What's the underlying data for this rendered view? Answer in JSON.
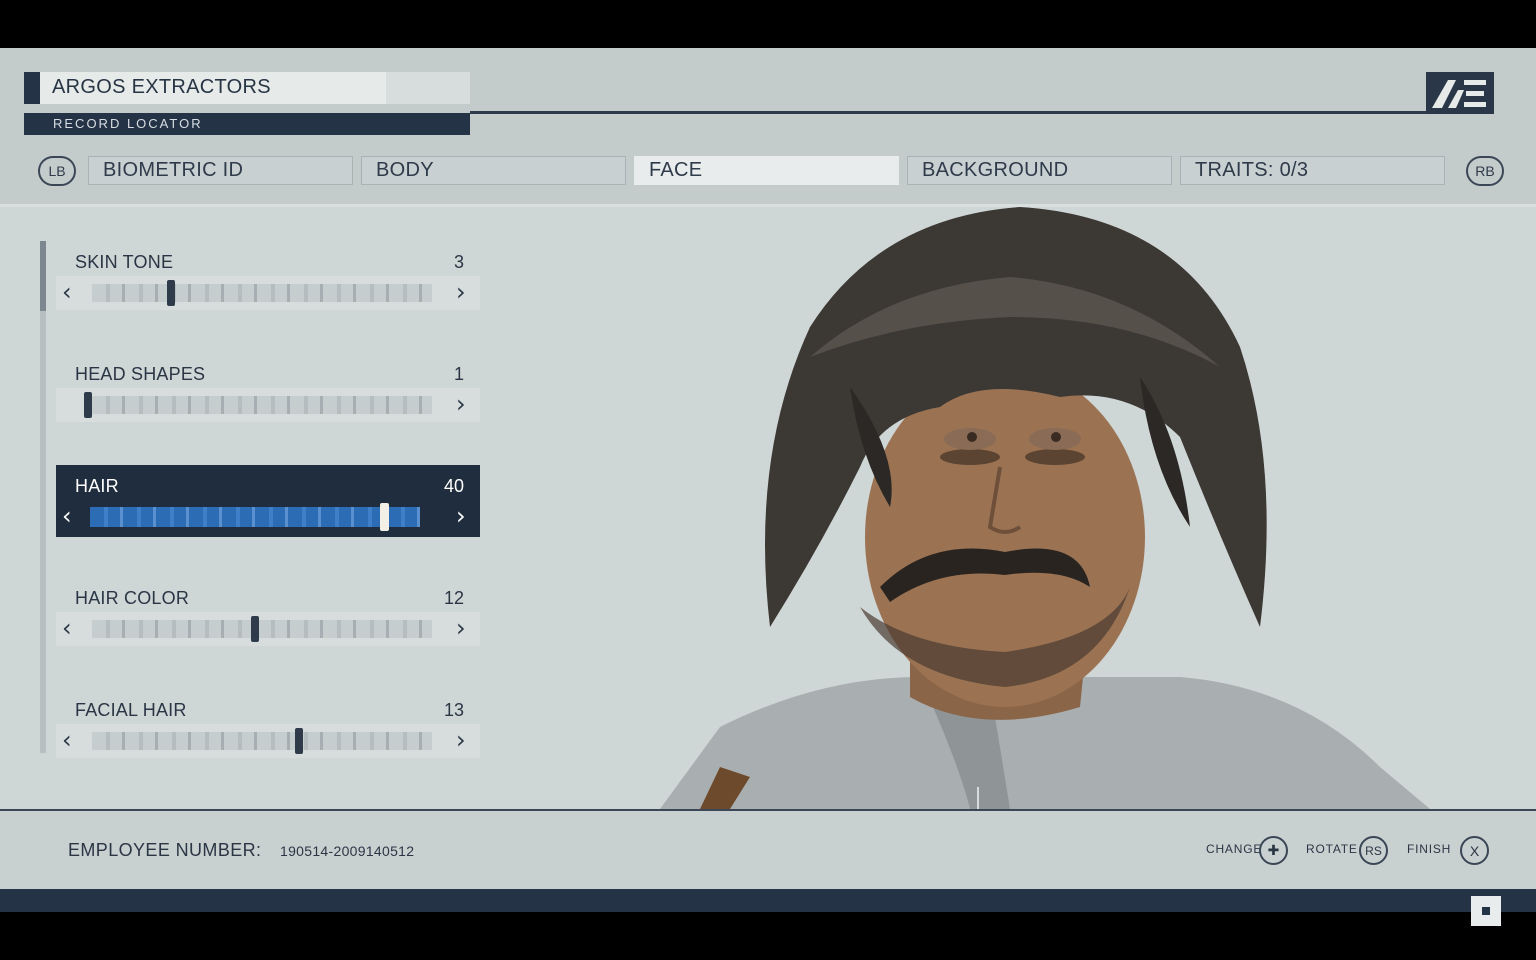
{
  "header": {
    "company_name": "ARGOS EXTRACTORS",
    "record_label": "RECORD LOCATOR",
    "logo_icon": "ae-logo-icon"
  },
  "tabs": {
    "left_bumper": "LB",
    "right_bumper": "RB",
    "items": [
      {
        "label": "BIOMETRIC ID",
        "active": false
      },
      {
        "label": "BODY",
        "active": false
      },
      {
        "label": "FACE",
        "active": true
      },
      {
        "label": "BACKGROUND",
        "active": false
      },
      {
        "label": "TRAITS: 0/3",
        "active": false
      }
    ]
  },
  "sliders": [
    {
      "label": "SKIN TONE",
      "value": "3"
    },
    {
      "label": "HEAD SHAPES",
      "value": "1"
    },
    {
      "label": "HAIR",
      "value": "40"
    },
    {
      "label": "HAIR COLOR",
      "value": "12"
    },
    {
      "label": "FACIAL HAIR",
      "value": "13"
    }
  ],
  "footer": {
    "employee_label": "EMPLOYEE NUMBER:",
    "employee_value": "190514-2009140512",
    "prompts": [
      {
        "label": "CHANGE",
        "button": "✚"
      },
      {
        "label": "ROTATE",
        "button": "RS"
      },
      {
        "label": "FINISH",
        "button": "X"
      }
    ]
  },
  "colors": {
    "panel": "#cfd6d6",
    "navy": "#243446",
    "selected_accent": "#2c6cb5"
  }
}
